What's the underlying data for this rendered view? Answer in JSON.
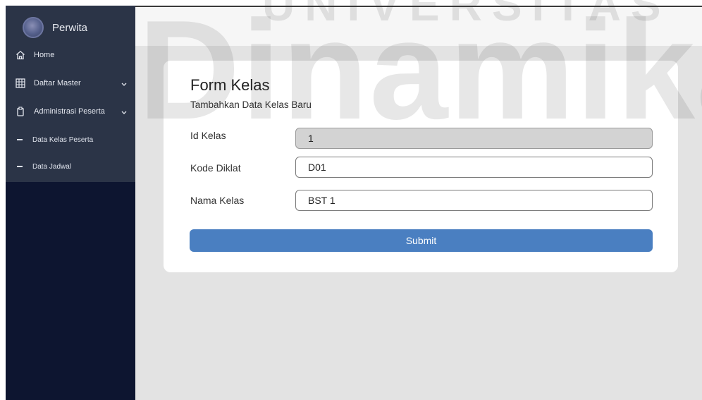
{
  "sidebar": {
    "brand": "Perwita",
    "items": [
      {
        "label": "Home",
        "icon": "home-icon"
      },
      {
        "label": "Daftar Master",
        "icon": "grid-icon"
      },
      {
        "label": "Administrasi Peserta",
        "icon": "clipboard-icon"
      }
    ],
    "subitems": [
      {
        "label": "Data Kelas Peserta"
      },
      {
        "label": "Data Jadwal"
      }
    ]
  },
  "form": {
    "title": "Form Kelas",
    "subtitle": "Tambahkan Data Kelas Baru",
    "fields": [
      {
        "label": "Id Kelas",
        "value": "1"
      },
      {
        "label": "Kode Diklat",
        "value": "D01"
      },
      {
        "label": "Nama Kelas",
        "value": "BST 1"
      }
    ],
    "submit_label": "Submit"
  },
  "watermark": {
    "top": "UNIVERSITAS",
    "main": "Dinamika"
  },
  "colors": {
    "sidebar": "#0d1530",
    "submit": "#4a7fc1",
    "background": "#e3e3e3"
  }
}
